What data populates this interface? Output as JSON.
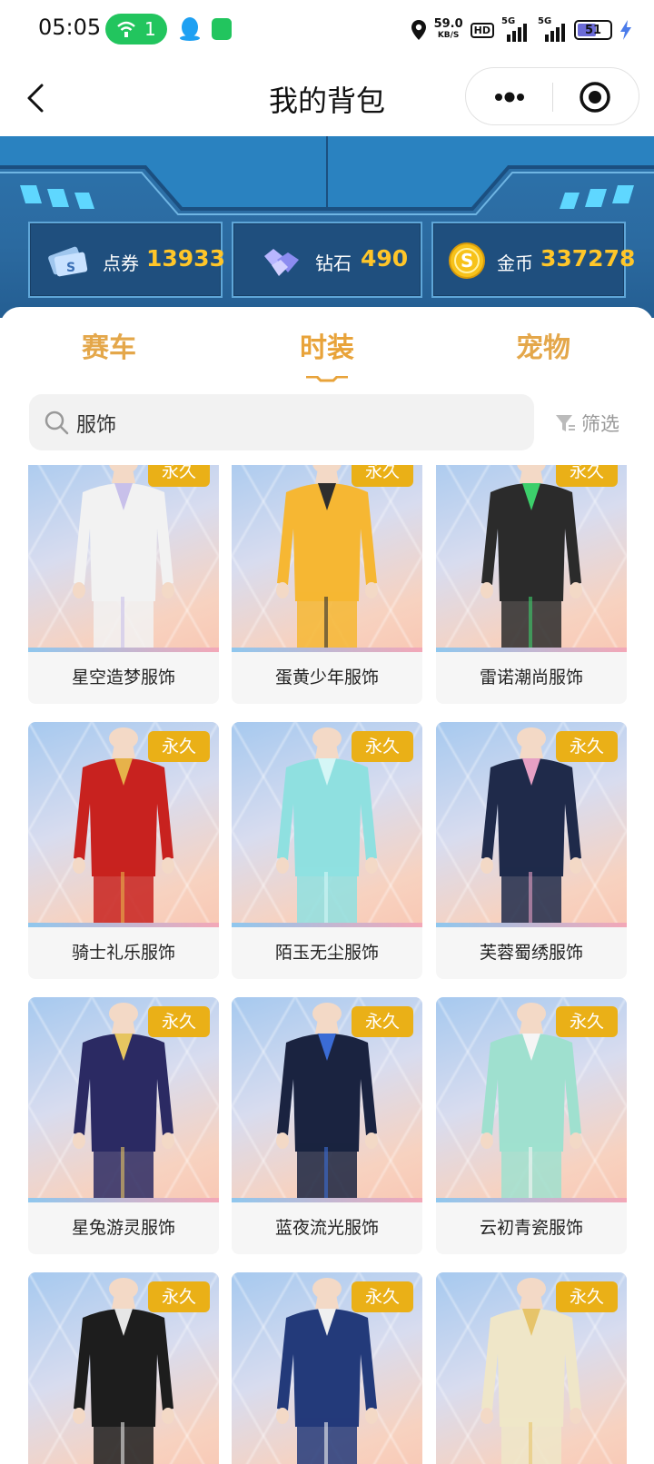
{
  "status_bar": {
    "time": "05:05",
    "wifi_count": "1",
    "net_speed": "59.0",
    "net_speed_unit": "KB/S",
    "hd": "HD",
    "signal_1": "5G",
    "signal_2": "5G",
    "battery": "51"
  },
  "nav": {
    "title": "我的背包"
  },
  "currency": {
    "coupon": {
      "label": "点券",
      "value": "13933"
    },
    "diamond": {
      "label": "钻石",
      "value": "490"
    },
    "gold": {
      "label": "金币",
      "value": "337278"
    }
  },
  "tabs": [
    {
      "label": "赛车",
      "active": false
    },
    {
      "label": "时装",
      "active": true
    },
    {
      "label": "宠物",
      "active": false
    }
  ],
  "search": {
    "text": "服饰"
  },
  "filter": {
    "label": "筛选"
  },
  "items": [
    {
      "name": "星空造梦服饰",
      "badge": "永久",
      "color": "#f2f2f2",
      "accent": "#c8c0ea"
    },
    {
      "name": "蛋黄少年服饰",
      "badge": "永久",
      "color": "#f6b733",
      "accent": "#2e2e2e"
    },
    {
      "name": "雷诺潮尚服饰",
      "badge": "永久",
      "color": "#2b2b2b",
      "accent": "#3ccf6b"
    },
    {
      "name": "骑士礼乐服饰",
      "badge": "永久",
      "color": "#c8221f",
      "accent": "#e6b24a"
    },
    {
      "name": "陌玉无尘服饰",
      "badge": "永久",
      "color": "#8fe0e0",
      "accent": "#d4f6f6"
    },
    {
      "name": "芙蓉蜀绣服饰",
      "badge": "永久",
      "color": "#1f2a4a",
      "accent": "#e6a0c4"
    },
    {
      "name": "星兔游灵服饰",
      "badge": "永久",
      "color": "#2b2a63",
      "accent": "#e6c560"
    },
    {
      "name": "蓝夜流光服饰",
      "badge": "永久",
      "color": "#1a2340",
      "accent": "#3b6cd6"
    },
    {
      "name": "云初青瓷服饰",
      "badge": "永久",
      "color": "#9fe0cf",
      "accent": "#f5f5f5"
    },
    {
      "name": "",
      "badge": "永久",
      "color": "#1d1d1d",
      "accent": "#e6e6e6"
    },
    {
      "name": "",
      "badge": "永久",
      "color": "#233a7a",
      "accent": "#f0f0f0"
    },
    {
      "name": "",
      "badge": "永久",
      "color": "#efe6c8",
      "accent": "#e6c46a"
    }
  ]
}
